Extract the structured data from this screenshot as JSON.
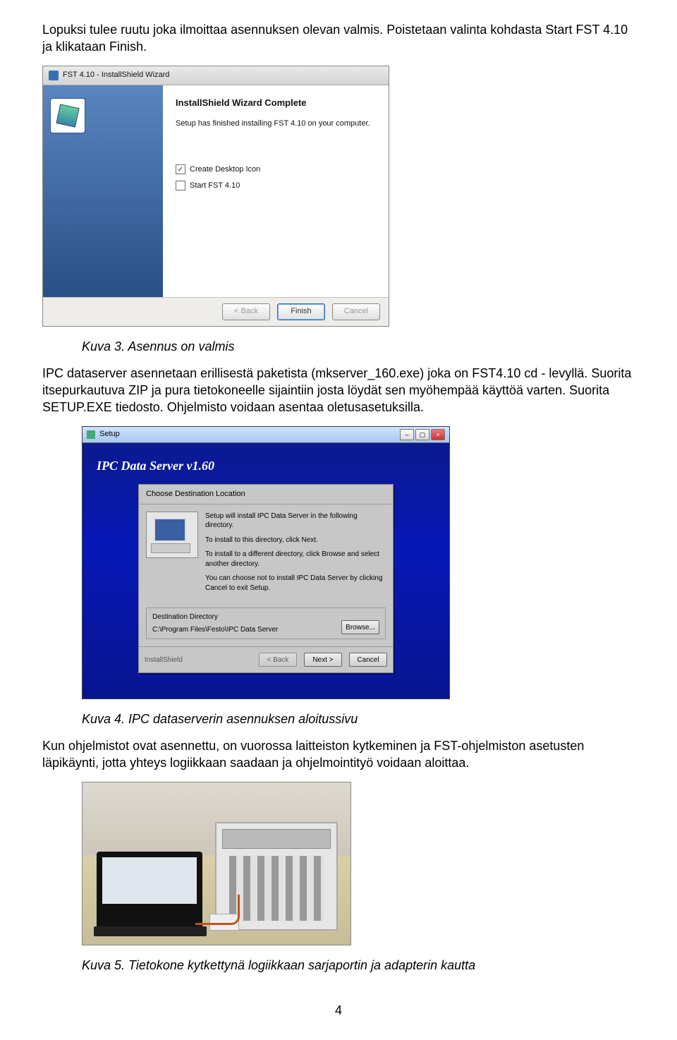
{
  "intro_para": "Lopuksi tulee ruutu joka ilmoittaa asennuksen olevan valmis. Poistetaan valinta kohdasta Start FST 4.10 ja klikataan Finish.",
  "fig1": {
    "window_title": "FST 4.10 - InstallShield Wizard",
    "heading": "InstallShield Wizard Complete",
    "line": "Setup has finished installing FST 4.10 on your computer.",
    "chk_desktop": "Create Desktop Icon",
    "chk_start": "Start FST 4.10",
    "btn_back": "< Back",
    "btn_finish": "Finish",
    "btn_cancel": "Cancel",
    "caption": "Kuva 3. Asennus on valmis"
  },
  "mid_para": "IPC dataserver asennetaan erillisestä paketista (mkserver_160.exe) joka on FST4.10 cd - levyllä. Suorita itsepurkautuva ZIP ja pura tietokoneelle sijaintiin josta löydät sen myöhempää käyttöä varten. Suorita SETUP.EXE tiedosto. Ohjelmisto voidaan asentaa oletusasetuksilla.",
  "fig2": {
    "window_title": "Setup",
    "app_title": "IPC Data Server v1.60",
    "dlg_head": "Choose Destination Location",
    "body_l1": "Setup will install IPC Data Server in the following directory.",
    "body_l2": "To install to this directory, click Next.",
    "body_l3": "To install to a different directory, click Browse and select another directory.",
    "body_l4": "You can choose not to install IPC Data Server by clicking Cancel to exit Setup.",
    "dest_label": "Destination Directory",
    "dest_path": "C:\\Program Files\\Festo\\IPC Data Server",
    "btn_browse": "Browse...",
    "btn_back": "< Back",
    "btn_next": "Next >",
    "btn_cancel": "Cancel",
    "install_shield": "InstallShield",
    "caption": "Kuva 4. IPC dataserverin asennuksen aloitussivu"
  },
  "after_fig2_para": "Kun ohjelmistot ovat asennettu, on vuorossa laitteiston kytkeminen ja FST-ohjelmiston asetusten läpikäynti, jotta yhteys logiikkaan saadaan ja ohjelmointityö voidaan aloittaa.",
  "fig3": {
    "caption": "Kuva 5. Tietokone kytkettynä logiikkaan sarjaportin ja adapterin kautta"
  },
  "page_number": "4"
}
